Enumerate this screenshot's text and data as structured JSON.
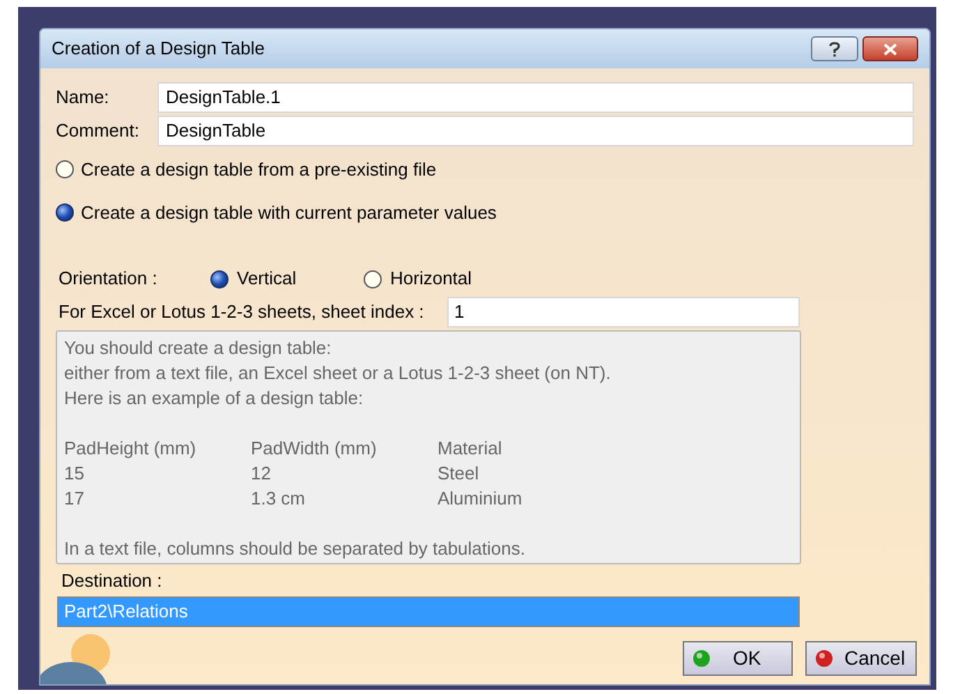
{
  "window": {
    "title": "Creation of a Design Table"
  },
  "fields": [
    {
      "label": "Name:",
      "value": "DesignTable.1"
    },
    {
      "label": "Comment:",
      "value": "DesignTable"
    }
  ],
  "source_options": [
    {
      "label": "Create a design table from a pre-existing file",
      "selected": false
    },
    {
      "label": "Create a design table with current parameter values",
      "selected": true
    }
  ],
  "orientation": {
    "label": "Orientation :",
    "options": [
      {
        "label": "Vertical",
        "selected": true
      },
      {
        "label": "Horizontal",
        "selected": false
      }
    ]
  },
  "sheet_index": {
    "label": "For Excel or Lotus 1-2-3 sheets, sheet index :",
    "value": "1"
  },
  "info": {
    "lines": [
      "You should create a design table:",
      "either from a text file, an Excel sheet or a Lotus 1-2-3 sheet (on NT).",
      "Here is an example of a design table:"
    ],
    "example_rows": [
      [
        "PadHeight (mm)",
        "PadWidth (mm)",
        "Material"
      ],
      [
        "15",
        "12",
        "Steel"
      ],
      [
        "17",
        "1.3 cm",
        "Aluminium"
      ]
    ],
    "note": "In a text file, columns should be separated by tabulations."
  },
  "destination": {
    "label": "Destination :",
    "items": [
      {
        "label": "Part2\\Relations",
        "selected": true
      }
    ]
  },
  "buttons": [
    {
      "label": "OK",
      "kind": "ok"
    },
    {
      "label": "Cancel",
      "kind": "cancel"
    }
  ]
}
